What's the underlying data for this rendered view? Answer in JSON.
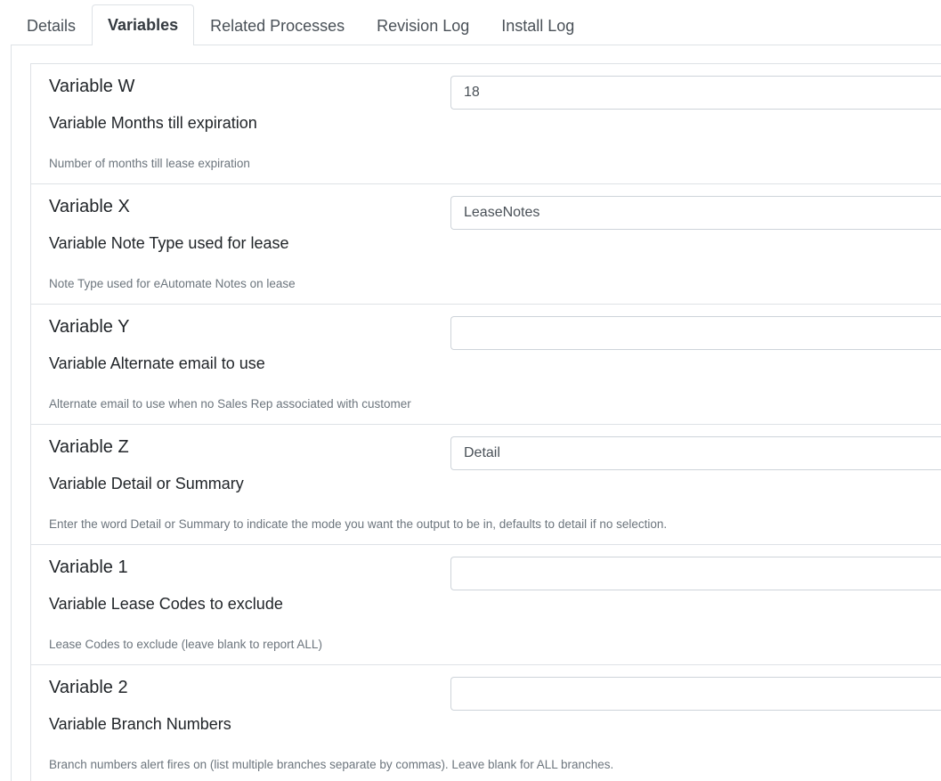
{
  "tabs": [
    {
      "label": "Details",
      "active": false
    },
    {
      "label": "Variables",
      "active": true
    },
    {
      "label": "Related Processes",
      "active": false
    },
    {
      "label": "Revision Log",
      "active": false
    },
    {
      "label": "Install Log",
      "active": false
    }
  ],
  "variables": [
    {
      "name": "Variable W",
      "label": "Variable Months till expiration",
      "value": "18",
      "description": "Number of months till lease expiration"
    },
    {
      "name": "Variable X",
      "label": "Variable Note Type used for lease",
      "value": "LeaseNotes",
      "description": "Note Type used for eAutomate Notes on lease"
    },
    {
      "name": "Variable Y",
      "label": "Variable Alternate email to use",
      "value": "",
      "description": "Alternate email to use when no Sales Rep associated with customer"
    },
    {
      "name": "Variable Z",
      "label": "Variable Detail or Summary",
      "value": "Detail",
      "description": "Enter the word Detail or Summary to indicate the mode you want the output to be in, defaults to detail if no selection."
    },
    {
      "name": "Variable 1",
      "label": "Variable Lease Codes to exclude",
      "value": "",
      "description": "Lease Codes to exclude (leave blank to report ALL)"
    },
    {
      "name": "Variable 2",
      "label": "Variable Branch Numbers",
      "value": "",
      "description": "Branch numbers alert fires on (list multiple branches separate by commas). Leave blank for ALL branches."
    }
  ]
}
